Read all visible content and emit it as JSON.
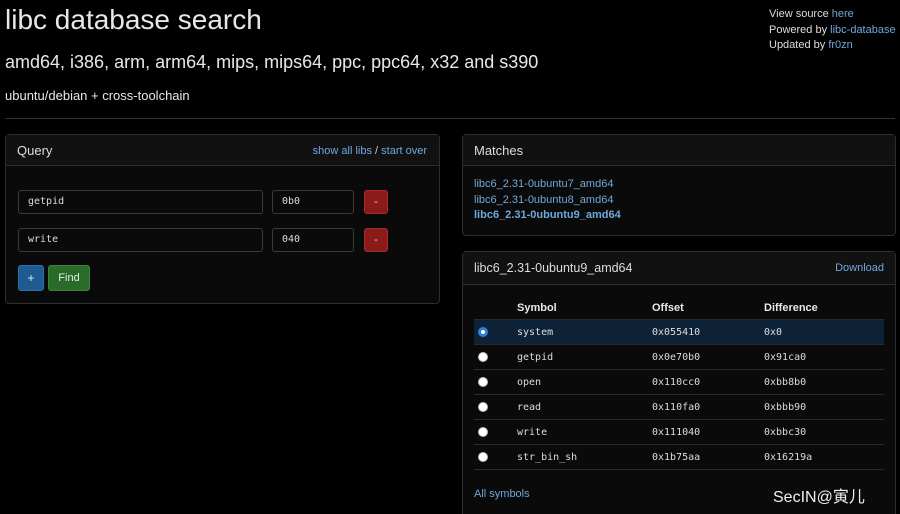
{
  "header": {
    "title": "libc database search",
    "archs": "amd64, i386, arm, arm64, mips, mips64, ppc, ppc64, x32 and s390",
    "sources": "ubuntu/debian + cross-toolchain"
  },
  "info": {
    "view_source_prefix": "View source",
    "view_source_link": "here",
    "powered_prefix": "Powered by",
    "powered_link": "libc-database",
    "updated_prefix": "Updated by",
    "updated_link": "fr0zn"
  },
  "query": {
    "title": "Query",
    "show_all_label": "show all libs",
    "separator": "/",
    "start_over_label": "start over",
    "rows": [
      {
        "symbol": "getpid",
        "offset": "0b0",
        "remove_label": "-"
      },
      {
        "symbol": "write",
        "offset": "040",
        "remove_label": "-"
      }
    ],
    "add_label": "+",
    "find_label": "Find"
  },
  "matches": {
    "title": "Matches",
    "items": [
      "libc6_2.31-0ubuntu7_amd64",
      "libc6_2.31-0ubuntu8_amd64",
      "libc6_2.31-0ubuntu9_amd64"
    ]
  },
  "detail": {
    "title": "libc6_2.31-0ubuntu9_amd64",
    "download_label": "Download",
    "columns": [
      "Symbol",
      "Offset",
      "Difference"
    ],
    "rows": [
      {
        "symbol": "system",
        "offset": "0x055410",
        "difference": "0x0",
        "selected": true
      },
      {
        "symbol": "getpid",
        "offset": "0x0e70b0",
        "difference": "0x91ca0",
        "selected": false
      },
      {
        "symbol": "open",
        "offset": "0x110cc0",
        "difference": "0xbb8b0",
        "selected": false
      },
      {
        "symbol": "read",
        "offset": "0x110fa0",
        "difference": "0xbbb90",
        "selected": false
      },
      {
        "symbol": "write",
        "offset": "0x111040",
        "difference": "0xbbc30",
        "selected": false
      },
      {
        "symbol": "str_bin_sh",
        "offset": "0x1b75aa",
        "difference": "0x16219a",
        "selected": false
      }
    ],
    "all_symbols_label": "All symbols"
  },
  "watermark": "SecIN@寅儿"
}
